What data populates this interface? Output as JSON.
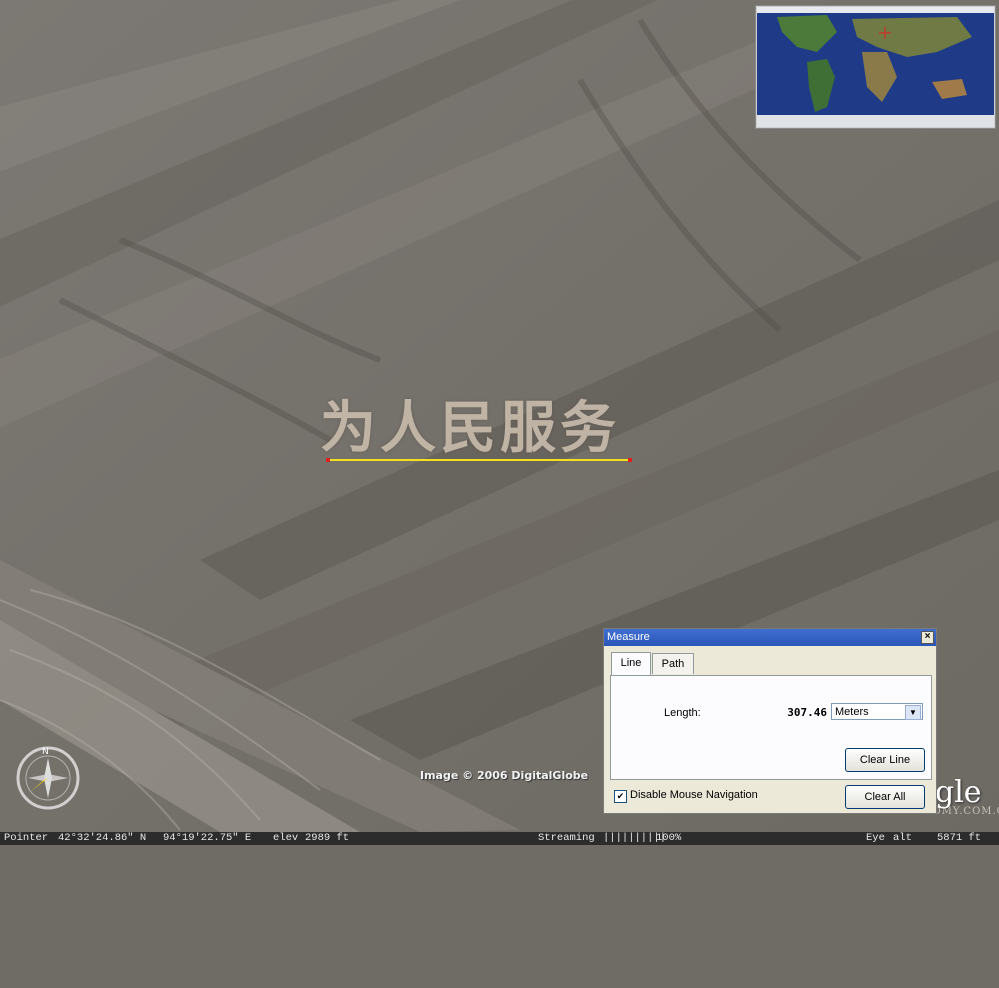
{
  "map": {
    "slogan": "为人民服务",
    "copyright": "Image © 2006 DigitalGlobe",
    "logo": "gle",
    "watermark": "WWW.ASTRONOMY.COM.CN"
  },
  "status": {
    "pointer_label": "Pointer",
    "latitude": "42°32'24.86\" N",
    "longitude": "94°19'22.75\" E",
    "elev_label": "elev",
    "elev_value": "2989 ft",
    "streaming_label": "Streaming",
    "streaming_bar": "||||||||||",
    "streaming_percent": "100%",
    "eye_label": "Eye",
    "alt_label": "alt",
    "alt_value": "5871 ft"
  },
  "measure": {
    "title": "Measure",
    "close_symbol": "×",
    "tabs": [
      {
        "label": "Line",
        "active": true
      },
      {
        "label": "Path",
        "active": false
      }
    ],
    "length_label": "Length:",
    "length_value": "307.46",
    "unit": "Meters",
    "clear_line": "Clear Line",
    "clear_all": "Clear All",
    "disable_nav_label": "Disable Mouse Navigation",
    "disable_nav_checked": true
  },
  "colors": {
    "measure_line": "#f0e020",
    "measure_endpoint": "#e02020",
    "titlebar": "#2a56b8"
  },
  "icons": {
    "compass": "compass-icon",
    "checkbox": "check-icon",
    "dropdown": "dropdown-arrow-icon"
  }
}
